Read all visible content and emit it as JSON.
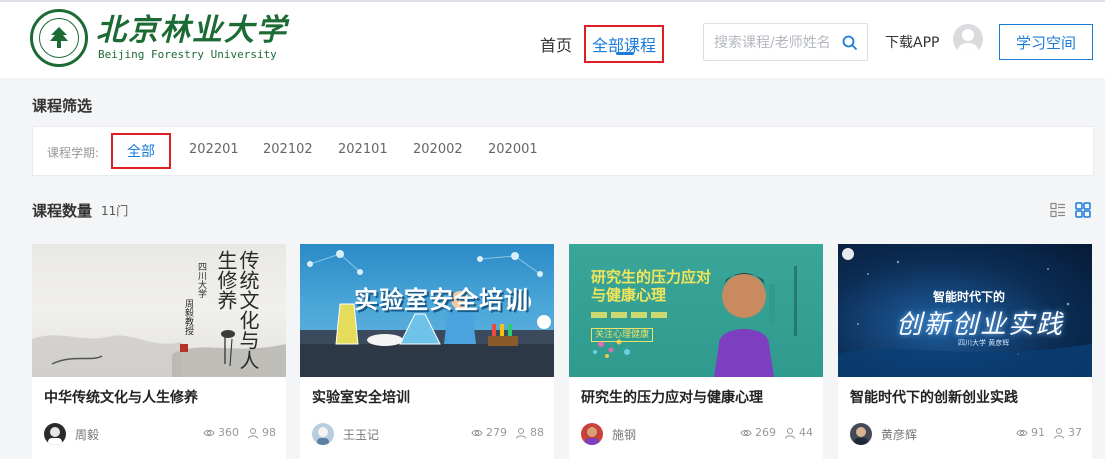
{
  "header": {
    "logo_cn": "北京林业大学",
    "logo_en": "Beijing Forestry University",
    "nav_home": "首页",
    "nav_all_courses": "全部课程",
    "search_placeholder": "搜索课程/老师姓名",
    "download_app": "下载APP",
    "study_space": "学习空间"
  },
  "filter": {
    "title": "课程筛选",
    "term_label": "课程学期:",
    "terms": [
      "全部",
      "202201",
      "202102",
      "202101",
      "202002",
      "202001"
    ],
    "selected": "全部"
  },
  "course_count": {
    "label": "课程数量",
    "value": "11门"
  },
  "courses": [
    {
      "title": "中华传统文化与人生修养",
      "teacher": "周毅",
      "views": "360",
      "students": "98",
      "image_text": {
        "big": "传统文化与人生修养",
        "small": "四川大学",
        "small2": "周毅教授"
      }
    },
    {
      "title": "实验室安全培训",
      "teacher": "王玉记",
      "views": "279",
      "students": "88",
      "image_text": {
        "big": "实验室安全培训"
      }
    },
    {
      "title": "研究生的压力应对与健康心理",
      "teacher": "施钢",
      "views": "269",
      "students": "44",
      "image_text": {
        "line1": "研究生的压力应对",
        "line2": "与健康心理",
        "tag": "关注心理健康"
      }
    },
    {
      "title": "智能时代下的创新创业实践",
      "teacher": "黄彦辉",
      "views": "91",
      "students": "37",
      "image_text": {
        "sub": "智能时代下的",
        "big": "创新创业实践",
        "small": "四川大学 黄彦辉"
      }
    }
  ],
  "colors": {
    "accent": "#1a7bd8",
    "highlight_box": "#e02020",
    "brand_green": "#1c6b35"
  }
}
